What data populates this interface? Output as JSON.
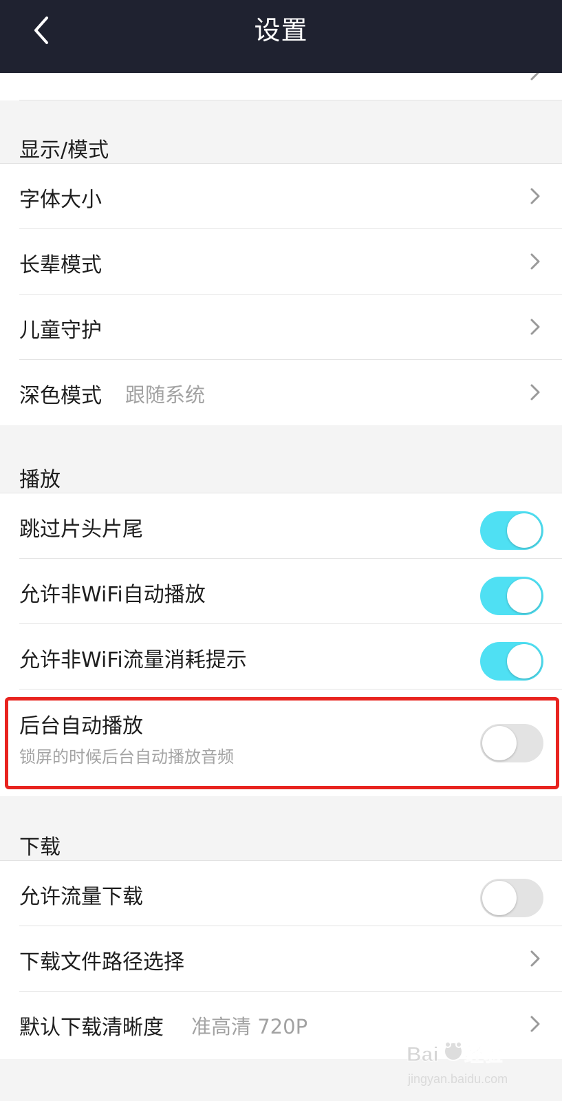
{
  "header": {
    "title": "设置",
    "back_icon": "chevron-left-icon"
  },
  "colors": {
    "topbar_bg": "#1f2230",
    "toggle_on": "#4fe0f3",
    "toggle_off": "#e3e3e3",
    "highlight": "#e8231f"
  },
  "display_section": {
    "title": "显示/模式",
    "items": [
      {
        "label": "字体大小"
      },
      {
        "label": "长辈模式"
      },
      {
        "label": "儿童守护"
      },
      {
        "label": "深色模式",
        "value": "跟随系统"
      }
    ]
  },
  "playback_section": {
    "title": "播放",
    "items": [
      {
        "label": "跳过片头片尾",
        "toggle": true
      },
      {
        "label": "允许非WiFi自动播放",
        "toggle": true
      },
      {
        "label": "允许非WiFi流量消耗提示",
        "toggle": true
      },
      {
        "label": "后台自动播放",
        "sublabel": "锁屏的时候后台自动播放音频",
        "toggle": false
      }
    ]
  },
  "download_section": {
    "title": "下载",
    "items": [
      {
        "label": "允许流量下载",
        "toggle": false
      },
      {
        "label": "下载文件路径选择"
      },
      {
        "label": "默认下载清晰度",
        "value": "准高清 720P"
      }
    ]
  }
}
